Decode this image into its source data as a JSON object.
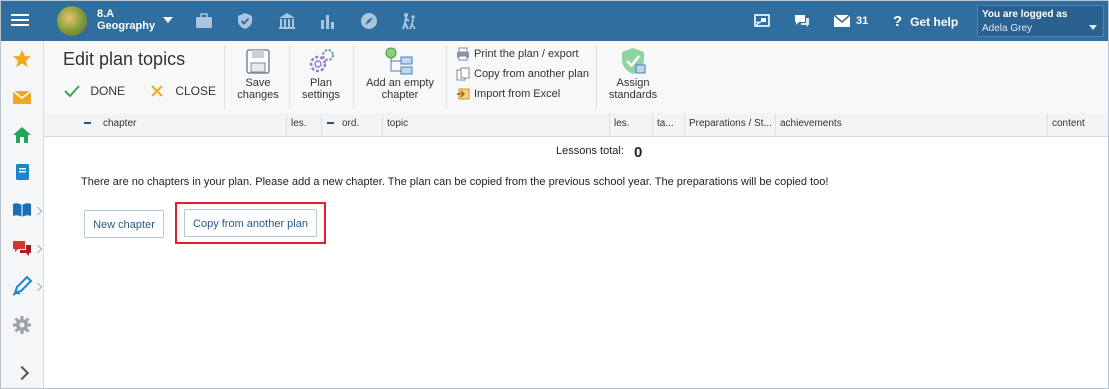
{
  "topbar": {
    "class": "8.A",
    "subject": "Geography",
    "messages_count": "31",
    "help_label": "Get help",
    "user_label": "You are logged as",
    "user_name": "Adela Grey",
    "colors": {
      "bar": "#2f6e9f"
    }
  },
  "toolbar": {
    "title": "Edit plan topics",
    "done": "DONE",
    "close": "CLOSE",
    "save_line1": "Save",
    "save_line2": "changes",
    "plan_line1": "Plan",
    "plan_line2": "settings",
    "add_line1": "Add an empty",
    "add_line2": "chapter",
    "print": "Print the plan / export",
    "copy": "Copy from another plan",
    "import": "Import from Excel",
    "assign_line1": "Assign",
    "assign_line2": "standards"
  },
  "table": {
    "columns": [
      "chapter",
      "les.",
      "ord.",
      "topic",
      "les.",
      "ta...",
      "Preparations / St...",
      "achievements",
      "content"
    ]
  },
  "content": {
    "lessons_total_label": "Lessons total:",
    "lessons_total": "0",
    "message": "There are no chapters in your plan. Please add a new chapter. The plan can be copied from the previous school year. The preparations will be copied too!",
    "new_chapter": "New chapter",
    "copy_from_another": "Copy from another plan"
  },
  "icons": {
    "nav": [
      "briefcase-icon",
      "shield-check-icon",
      "school-building-icon",
      "bar-chart-icon",
      "compass-icon",
      "walking-people-icon"
    ],
    "topright": [
      "screen-cast-icon",
      "chat-bubbles-icon",
      "envelope-icon",
      "question-icon"
    ],
    "sidebar": [
      "star-icon",
      "mail-icon",
      "home-icon",
      "notebook-icon",
      "book-open-icon",
      "chat-icon",
      "pen-icon",
      "gear-icon"
    ]
  }
}
